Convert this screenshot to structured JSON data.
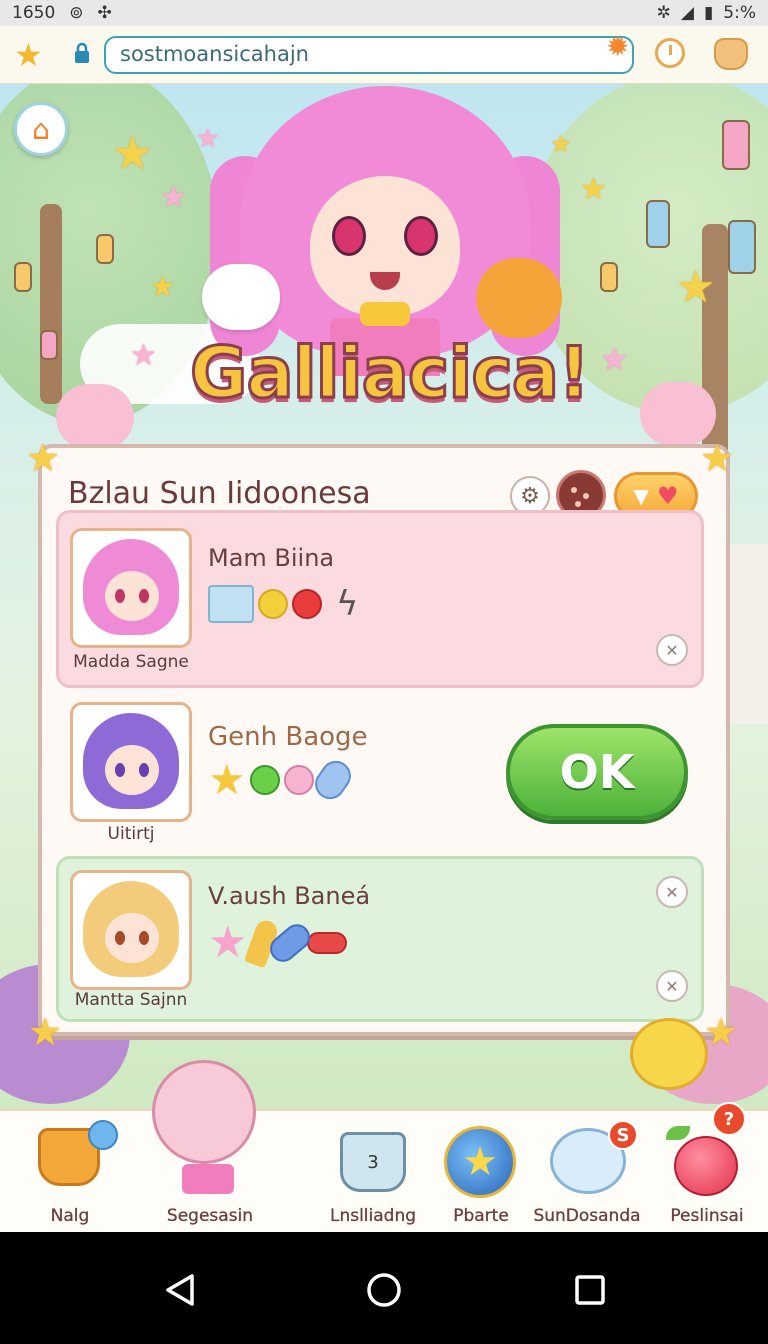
{
  "status_bar": {
    "time": "1650",
    "battery": "5:%"
  },
  "browser": {
    "url": "sostmoansicahajn"
  },
  "game": {
    "logo": "Galliacica!"
  },
  "panel": {
    "title": "Bzlau Sun Iidoonesa",
    "settings_glyph": "⚙"
  },
  "cards": [
    {
      "avatar_caption": "Madda Sagne",
      "name": "Mam Biina"
    },
    {
      "avatar_caption": "Uitirtj",
      "name": "Genh Baoge",
      "action_label": "OK"
    },
    {
      "avatar_caption": "Mantta Sajnn",
      "name": "V.aush Baneá"
    }
  ],
  "dock": {
    "items": [
      {
        "label": "Nalg"
      },
      {
        "label": "Segesasin"
      },
      {
        "label": "Lnslliadng",
        "counter": "3"
      },
      {
        "label": "Pbarte"
      },
      {
        "label": "SunDosanda",
        "badge": "S"
      },
      {
        "label": "Peslinsai",
        "badge": "?"
      }
    ]
  },
  "colors": {
    "accent_pink": "#f18bd8",
    "ok_green": "#4db23a",
    "panel_bg": "#fff9f6"
  }
}
